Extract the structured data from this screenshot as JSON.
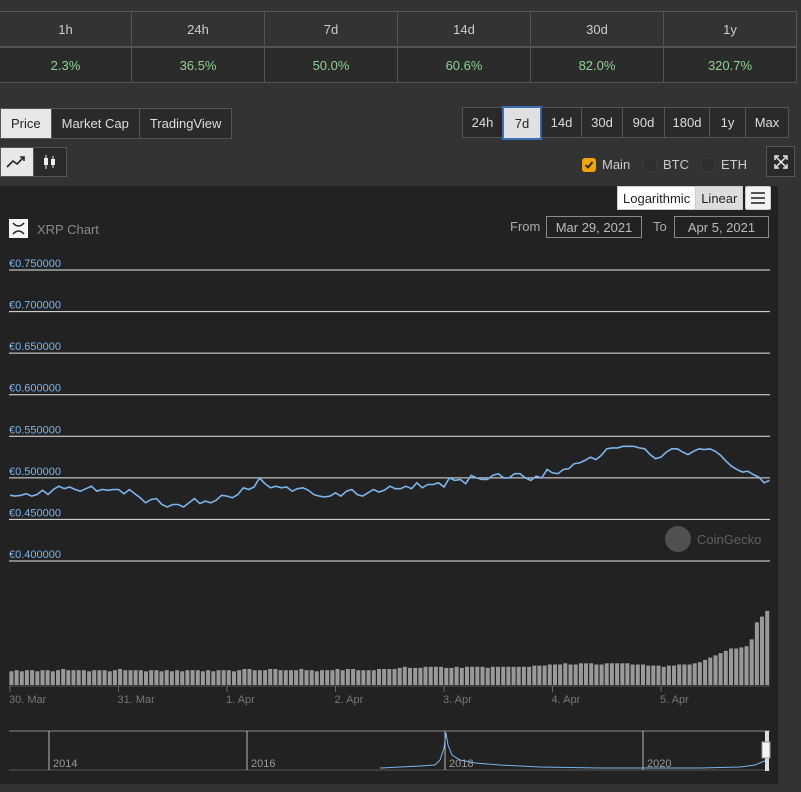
{
  "stats": {
    "periods": [
      "1h",
      "24h",
      "7d",
      "14d",
      "30d",
      "1y"
    ],
    "changes": [
      "2.3%",
      "36.5%",
      "50.0%",
      "60.6%",
      "82.0%",
      "320.7%"
    ],
    "change_color": "#8fd18f"
  },
  "chart_tabs": {
    "items": [
      "Price",
      "Market Cap",
      "TradingView"
    ],
    "active": "Price"
  },
  "ranges": {
    "items": [
      "24h",
      "7d",
      "14d",
      "30d",
      "90d",
      "180d",
      "1y",
      "Max"
    ],
    "selected": "7d"
  },
  "chart_style": {
    "icons": [
      "line-chart-icon",
      "candlestick-icon"
    ],
    "active": "line-chart-icon"
  },
  "compare": {
    "main_label": "Main",
    "main_checked": true,
    "btc_label": "BTC",
    "btc_checked": false,
    "eth_label": "ETH",
    "eth_checked": false
  },
  "scale": {
    "logarithmic_label": "Logarithmic",
    "linear_label": "Linear",
    "active": "Linear"
  },
  "chart": {
    "title": "XRP Chart",
    "from_label": "From",
    "from_value": "Mar 29, 2021",
    "to_label": "To",
    "to_value": "Apr 5, 2021",
    "watermark": "CoinGecko"
  },
  "chart_data": {
    "type": "line",
    "title": "XRP Chart",
    "currency": "€",
    "ylim": [
      0.4,
      0.75
    ],
    "yticks": [
      "€0.750000",
      "€0.700000",
      "€0.650000",
      "€0.600000",
      "€0.550000",
      "€0.500000",
      "€0.450000",
      "€0.400000"
    ],
    "ytick_values": [
      0.75,
      0.7,
      0.65,
      0.6,
      0.55,
      0.5,
      0.45,
      0.4
    ],
    "xlim": [
      0,
      7.0
    ],
    "xticks": [
      "30. Mar",
      "31. Mar",
      "1. Apr",
      "2. Apr",
      "3. Apr",
      "4. Apr",
      "5. Apr"
    ],
    "xtick_values": [
      0,
      1,
      2,
      3,
      4,
      5,
      6
    ],
    "line_color": "#7cb5ec",
    "grid": true,
    "series": [
      {
        "values": [
          [
            0.0,
            0.479
          ],
          [
            0.05,
            0.478
          ],
          [
            0.1,
            0.479
          ],
          [
            0.15,
            0.481
          ],
          [
            0.2,
            0.478
          ],
          [
            0.25,
            0.48
          ],
          [
            0.3,
            0.485
          ],
          [
            0.35,
            0.48
          ],
          [
            0.4,
            0.486
          ],
          [
            0.45,
            0.49
          ],
          [
            0.5,
            0.487
          ],
          [
            0.55,
            0.489
          ],
          [
            0.6,
            0.486
          ],
          [
            0.65,
            0.484
          ],
          [
            0.7,
            0.487
          ],
          [
            0.75,
            0.49
          ],
          [
            0.8,
            0.484
          ],
          [
            0.85,
            0.486
          ],
          [
            0.9,
            0.485
          ],
          [
            0.95,
            0.486
          ],
          [
            1.0,
            0.486
          ],
          [
            1.05,
            0.481
          ],
          [
            1.1,
            0.486
          ],
          [
            1.15,
            0.481
          ],
          [
            1.2,
            0.476
          ],
          [
            1.25,
            0.47
          ],
          [
            1.3,
            0.474
          ],
          [
            1.35,
            0.475
          ],
          [
            1.4,
            0.468
          ],
          [
            1.45,
            0.465
          ],
          [
            1.5,
            0.468
          ],
          [
            1.55,
            0.468
          ],
          [
            1.6,
            0.465
          ],
          [
            1.65,
            0.47
          ],
          [
            1.7,
            0.475
          ],
          [
            1.75,
            0.469
          ],
          [
            1.8,
            0.472
          ],
          [
            1.85,
            0.47
          ],
          [
            1.9,
            0.473
          ],
          [
            1.95,
            0.479
          ],
          [
            2.0,
            0.478
          ],
          [
            2.05,
            0.476
          ],
          [
            2.1,
            0.48
          ],
          [
            2.15,
            0.488
          ],
          [
            2.2,
            0.486
          ],
          [
            2.25,
            0.489
          ],
          [
            2.3,
            0.5
          ],
          [
            2.35,
            0.493
          ],
          [
            2.4,
            0.488
          ],
          [
            2.45,
            0.49
          ],
          [
            2.5,
            0.488
          ],
          [
            2.55,
            0.489
          ],
          [
            2.6,
            0.484
          ],
          [
            2.65,
            0.487
          ],
          [
            2.7,
            0.488
          ],
          [
            2.75,
            0.485
          ],
          [
            2.8,
            0.48
          ],
          [
            2.85,
            0.478
          ],
          [
            2.9,
            0.477
          ],
          [
            2.95,
            0.478
          ],
          [
            3.0,
            0.482
          ],
          [
            3.05,
            0.478
          ],
          [
            3.1,
            0.484
          ],
          [
            3.15,
            0.486
          ],
          [
            3.2,
            0.48
          ],
          [
            3.25,
            0.478
          ],
          [
            3.3,
            0.482
          ],
          [
            3.35,
            0.486
          ],
          [
            3.4,
            0.483
          ],
          [
            3.45,
            0.485
          ],
          [
            3.5,
            0.49
          ],
          [
            3.55,
            0.487
          ],
          [
            3.6,
            0.487
          ],
          [
            3.65,
            0.49
          ],
          [
            3.7,
            0.487
          ],
          [
            3.75,
            0.494
          ],
          [
            3.8,
            0.488
          ],
          [
            3.85,
            0.492
          ],
          [
            3.9,
            0.492
          ],
          [
            3.95,
            0.494
          ],
          [
            4.0,
            0.489
          ],
          [
            4.05,
            0.5
          ],
          [
            4.1,
            0.497
          ],
          [
            4.15,
            0.498
          ],
          [
            4.2,
            0.493
          ],
          [
            4.25,
            0.503
          ],
          [
            4.3,
            0.5
          ],
          [
            4.35,
            0.498
          ],
          [
            4.4,
            0.498
          ],
          [
            4.45,
            0.503
          ],
          [
            4.5,
            0.505
          ],
          [
            4.55,
            0.5
          ],
          [
            4.6,
            0.5
          ],
          [
            4.65,
            0.505
          ],
          [
            4.7,
            0.505
          ],
          [
            4.75,
            0.5
          ],
          [
            4.8,
            0.497
          ],
          [
            4.85,
            0.502
          ],
          [
            4.9,
            0.5
          ],
          [
            4.95,
            0.51
          ],
          [
            5.0,
            0.506
          ],
          [
            5.05,
            0.505
          ],
          [
            5.1,
            0.51
          ],
          [
            5.15,
            0.511
          ],
          [
            5.2,
            0.517
          ],
          [
            5.25,
            0.518
          ],
          [
            5.3,
            0.521
          ],
          [
            5.35,
            0.525
          ],
          [
            5.4,
            0.522
          ],
          [
            5.45,
            0.527
          ],
          [
            5.5,
            0.535
          ],
          [
            5.55,
            0.536
          ],
          [
            5.6,
            0.536
          ],
          [
            5.65,
            0.538
          ],
          [
            5.7,
            0.538
          ],
          [
            5.75,
            0.538
          ],
          [
            5.8,
            0.536
          ],
          [
            5.85,
            0.535
          ],
          [
            5.9,
            0.528
          ],
          [
            5.95,
            0.523
          ],
          [
            6.0,
            0.525
          ],
          [
            6.05,
            0.531
          ],
          [
            6.1,
            0.535
          ],
          [
            6.15,
            0.535
          ],
          [
            6.2,
            0.531
          ],
          [
            6.25,
            0.528
          ],
          [
            6.3,
            0.532
          ],
          [
            6.35,
            0.535
          ],
          [
            6.4,
            0.534
          ],
          [
            6.45,
            0.535
          ],
          [
            6.5,
            0.532
          ],
          [
            6.55,
            0.527
          ],
          [
            6.6,
            0.52
          ],
          [
            6.65,
            0.514
          ],
          [
            6.7,
            0.51
          ],
          [
            6.75,
            0.507
          ],
          [
            6.8,
            0.508
          ],
          [
            6.85,
            0.504
          ],
          [
            6.9,
            0.501
          ],
          [
            6.95,
            0.494
          ],
          [
            7.0,
            0.497
          ]
        ]
      }
    ],
    "volume": [
      0.12,
      0.13,
      0.12,
      0.13,
      0.13,
      0.12,
      0.13,
      0.13,
      0.12,
      0.13,
      0.14,
      0.13,
      0.13,
      0.13,
      0.13,
      0.12,
      0.13,
      0.13,
      0.13,
      0.12,
      0.13,
      0.14,
      0.13,
      0.13,
      0.13,
      0.13,
      0.12,
      0.13,
      0.13,
      0.12,
      0.13,
      0.12,
      0.13,
      0.12,
      0.13,
      0.13,
      0.13,
      0.12,
      0.13,
      0.12,
      0.13,
      0.13,
      0.13,
      0.12,
      0.13,
      0.14,
      0.14,
      0.13,
      0.13,
      0.13,
      0.14,
      0.14,
      0.13,
      0.13,
      0.13,
      0.13,
      0.14,
      0.13,
      0.13,
      0.12,
      0.13,
      0.13,
      0.13,
      0.14,
      0.13,
      0.14,
      0.14,
      0.13,
      0.13,
      0.13,
      0.13,
      0.14,
      0.14,
      0.14,
      0.14,
      0.15,
      0.16,
      0.15,
      0.15,
      0.15,
      0.16,
      0.16,
      0.16,
      0.16,
      0.15,
      0.15,
      0.16,
      0.15,
      0.16,
      0.16,
      0.16,
      0.16,
      0.15,
      0.16,
      0.16,
      0.16,
      0.16,
      0.16,
      0.16,
      0.16,
      0.16,
      0.17,
      0.17,
      0.17,
      0.18,
      0.18,
      0.18,
      0.19,
      0.18,
      0.18,
      0.19,
      0.19,
      0.19,
      0.18,
      0.18,
      0.19,
      0.19,
      0.19,
      0.19,
      0.19,
      0.18,
      0.18,
      0.18,
      0.17,
      0.17,
      0.17,
      0.16,
      0.17,
      0.17,
      0.18,
      0.18,
      0.18,
      0.19,
      0.2,
      0.22,
      0.24,
      0.26,
      0.28,
      0.3,
      0.32,
      0.32,
      0.33,
      0.34,
      0.4,
      0.55,
      0.6,
      0.65
    ],
    "navigator": {
      "xticks": [
        "2014",
        "2016",
        "2018",
        "2020"
      ]
    }
  }
}
